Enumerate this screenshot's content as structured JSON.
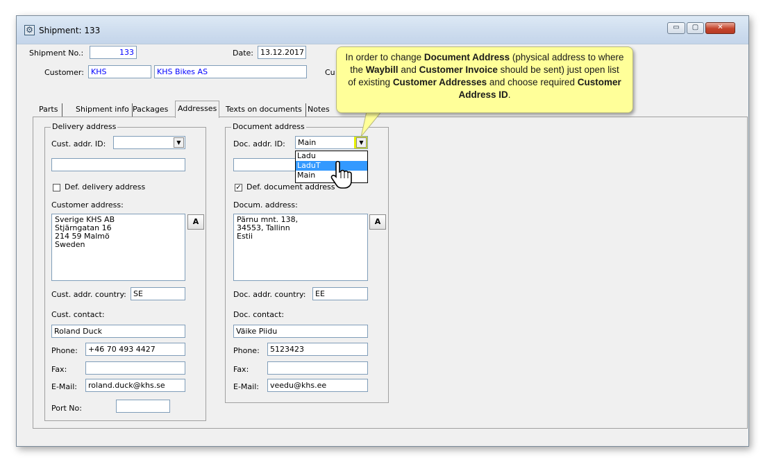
{
  "window": {
    "title": "Shipment: 133",
    "controls": {
      "minimize": "▭",
      "maximize": "▢",
      "close": "✕"
    }
  },
  "header": {
    "shipment_no_label": "Shipment No.:",
    "shipment_no": "133",
    "date_label": "Date:",
    "date": "13.12.2017",
    "customer_label": "Customer:",
    "customer_code": "KHS",
    "customer_name": "KHS Bikes AS",
    "cu_label_fragment": "Cu"
  },
  "tabs": [
    {
      "label": "Parts"
    },
    {
      "label": "Shipment info"
    },
    {
      "label": "Packages"
    },
    {
      "label": "Addresses",
      "active": true
    },
    {
      "label": "Texts on documents"
    },
    {
      "label": "Notes"
    }
  ],
  "delivery": {
    "group_title": "Delivery address",
    "id_label": "Cust. addr. ID:",
    "id_value": "",
    "name_value": "",
    "default_label": "Def. delivery address",
    "default_checked": false,
    "address_label": "Customer address:",
    "address": "Sverige KHS AB\nStjärngatan 16\n214 59 Malmö\nSweden",
    "a_button": "A",
    "country_label": "Cust. addr. country:",
    "country": "SE",
    "contact_label": "Cust. contact:",
    "contact": "Roland Duck",
    "phone_label": "Phone:",
    "phone": "+46 70 493 4427",
    "fax_label": "Fax:",
    "fax": "",
    "email_label": "E-Mail:",
    "email": "roland.duck@khs.se",
    "port_label": "Port No:",
    "port": ""
  },
  "document": {
    "group_title": "Document address",
    "id_label": "Doc. addr. ID:",
    "id_value": "Main",
    "options": [
      "Ladu",
      "LaduT",
      "Main"
    ],
    "highlighted_option": "LaduT",
    "name_value": "",
    "default_label": "Def. document address",
    "default_checked": true,
    "address_label": "Docum. address:",
    "address": "Pärnu mnt. 138,\n34553, Tallinn\nEstii",
    "a_button": "A",
    "country_label": "Doc. addr. country:",
    "country": "EE",
    "contact_label": "Doc. contact:",
    "contact": "Väike Piidu",
    "phone_label": "Phone:",
    "phone": "5123423",
    "fax_label": "Fax:",
    "fax": "",
    "email_label": "E-Mail:",
    "email": "veedu@khs.ee"
  },
  "callout": {
    "parts": [
      {
        "t": "In order to change "
      },
      {
        "t": "Document Address",
        "b": true
      },
      {
        "t": " (physical address to where the "
      },
      {
        "t": "Waybill",
        "b": true
      },
      {
        "t": " and "
      },
      {
        "t": "Customer Invoice",
        "b": true
      },
      {
        "t": " should be sent) just open list of existing "
      },
      {
        "t": "Customer Addresses",
        "b": true
      },
      {
        "t": "  and choose required "
      },
      {
        "t": "Customer Address ID",
        "b": true
      },
      {
        "t": "."
      }
    ],
    "color": "#ffff99",
    "highlight_color": "#e6f000"
  },
  "colors": {
    "selection": "#3399ff",
    "field_text_blue": "#0000ff"
  },
  "icons": {
    "app": "shipment-app-icon",
    "pointer": "hand-pointer-icon"
  }
}
